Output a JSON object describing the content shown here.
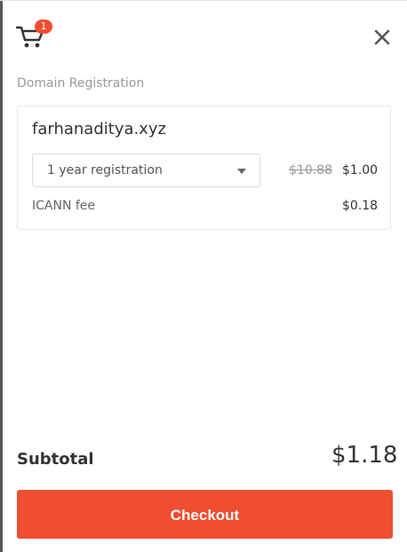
{
  "cart": {
    "count": "1",
    "icon": "shopping-cart-icon"
  },
  "close": {
    "icon": "close-icon"
  },
  "section_title": "Domain Registration",
  "item": {
    "domain": "farhanaditya.xyz",
    "period_selected": "1 year registration",
    "price_old": "$10.88",
    "price_new": "$1.00",
    "fee_label": "ICANN fee",
    "fee_value": "$0.18"
  },
  "subtotal": {
    "label": "Subtotal",
    "value": "$1.18"
  },
  "checkout": {
    "label": "Checkout"
  },
  "colors": {
    "accent": "#f04e30",
    "text": "#333333",
    "muted": "#999999"
  }
}
